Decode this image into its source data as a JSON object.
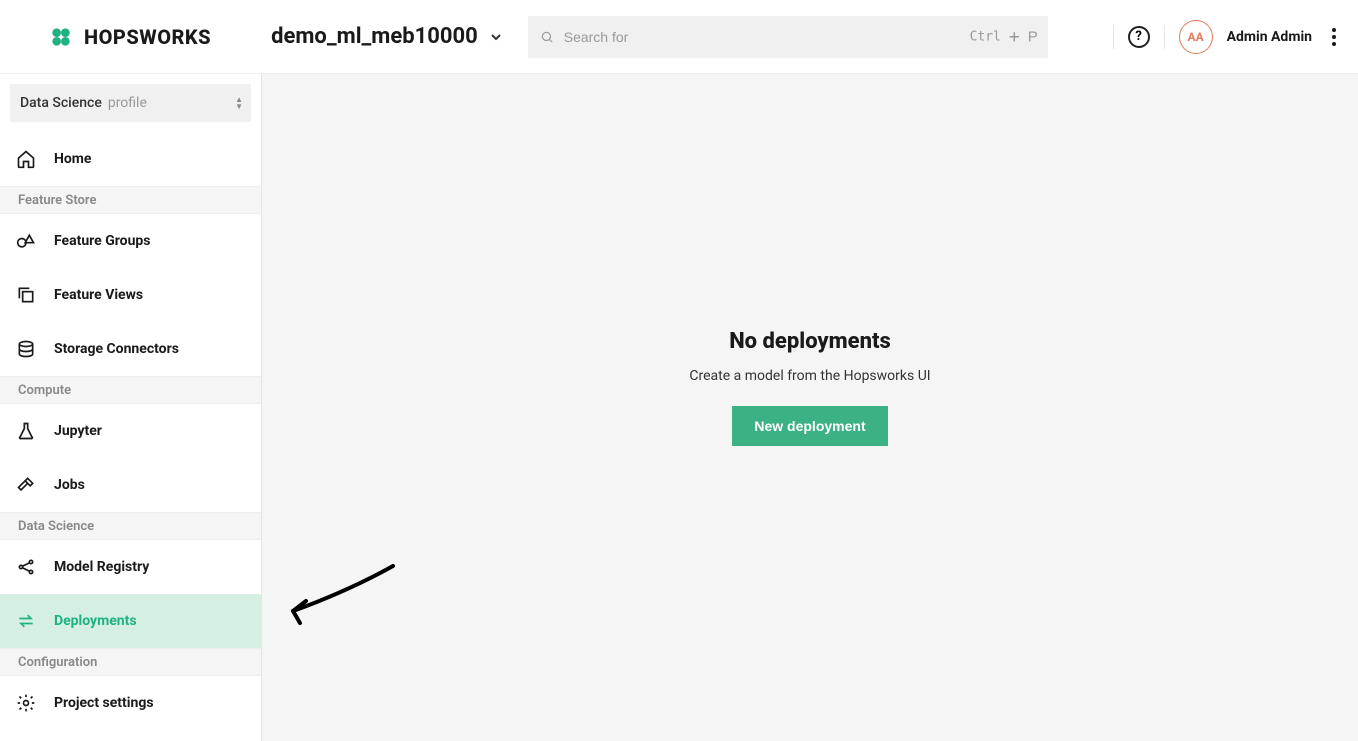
{
  "header": {
    "logo_text": "HOPSWORKS",
    "project_name": "demo_ml_meb10000",
    "search_placeholder": "Search for",
    "shortcut_ctrl": "Ctrl",
    "shortcut_plus": "+",
    "shortcut_p": "P",
    "help_label": "?",
    "avatar_initials": "AA",
    "username": "Admin Admin"
  },
  "sidebar": {
    "profile_main": "Data Science",
    "profile_sub": "profile",
    "items": {
      "home": "Home",
      "feature_groups": "Feature Groups",
      "feature_views": "Feature Views",
      "storage_connectors": "Storage Connectors",
      "jupyter": "Jupyter",
      "jobs": "Jobs",
      "model_registry": "Model Registry",
      "deployments": "Deployments",
      "project_settings": "Project settings"
    },
    "sections": {
      "feature_store": "Feature Store",
      "compute": "Compute",
      "data_science": "Data Science",
      "configuration": "Configuration"
    }
  },
  "empty": {
    "title": "No deployments",
    "subtitle": "Create a model from the Hopsworks UI",
    "button": "New deployment"
  }
}
